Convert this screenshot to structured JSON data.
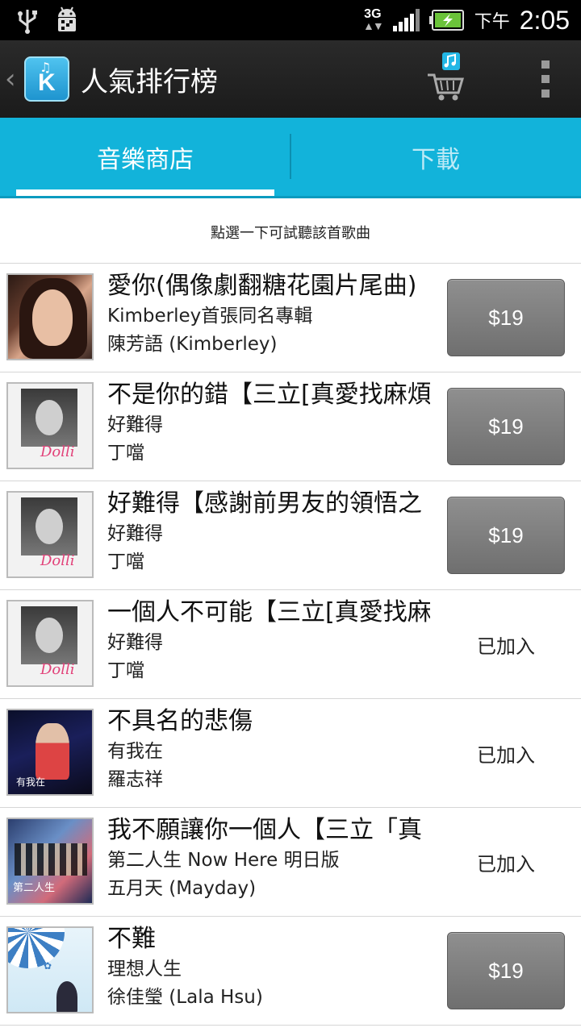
{
  "status_bar": {
    "network": "3G",
    "time_prefix": "下午",
    "time": "2:05",
    "icons": [
      "usb-icon",
      "android-debug-icon",
      "network-3g-icon",
      "signal-icon",
      "battery-charging-icon"
    ]
  },
  "action_bar": {
    "title": "人氣排行榜",
    "back_glyph": "‹",
    "logo_letter": "K",
    "actions": [
      "cart-icon",
      "overflow-menu-icon"
    ]
  },
  "tabs": [
    {
      "label": "音樂商店",
      "active": true
    },
    {
      "label": "下載",
      "active": false
    }
  ],
  "hint": "點選一下可試聽該首歌曲",
  "songs": [
    {
      "title": "愛你(偶像劇翻糖花園片尾曲)",
      "album": "Kimberley首張同名專輯",
      "artist": "陳芳語 (Kimberley)",
      "price": "$19",
      "status": ""
    },
    {
      "title": "不是你的錯【三立[真愛找麻煩",
      "album": "好難得",
      "artist": "丁噹",
      "price": "$19",
      "status": ""
    },
    {
      "title": "好難得【感謝前男友的領悟之",
      "album": "好難得",
      "artist": "丁噹",
      "price": "$19",
      "status": ""
    },
    {
      "title": "一個人不可能【三立[真愛找麻",
      "album": "好難得",
      "artist": "丁噹",
      "price": "",
      "status": "已加入"
    },
    {
      "title": "不具名的悲傷",
      "album": "有我在",
      "artist": "羅志祥",
      "price": "",
      "status": "已加入"
    },
    {
      "title": "我不願讓你一個人【三立「真",
      "album": "第二人生 Now Here 明日版",
      "artist": "五月天 (Mayday)",
      "price": "",
      "status": "已加入"
    },
    {
      "title": "不難",
      "album": "理想人生",
      "artist": "徐佳瑩 (Lala Hsu)",
      "price": "$19",
      "status": ""
    }
  ],
  "cover_text": {
    "c2_sig": "Dolli",
    "c5_text": "有我在",
    "c6_text": "第二人生"
  },
  "colors": {
    "tab_bar": "#12b3da",
    "action_bar": "#1b1b1b",
    "price_button": "#7f7f7f"
  }
}
